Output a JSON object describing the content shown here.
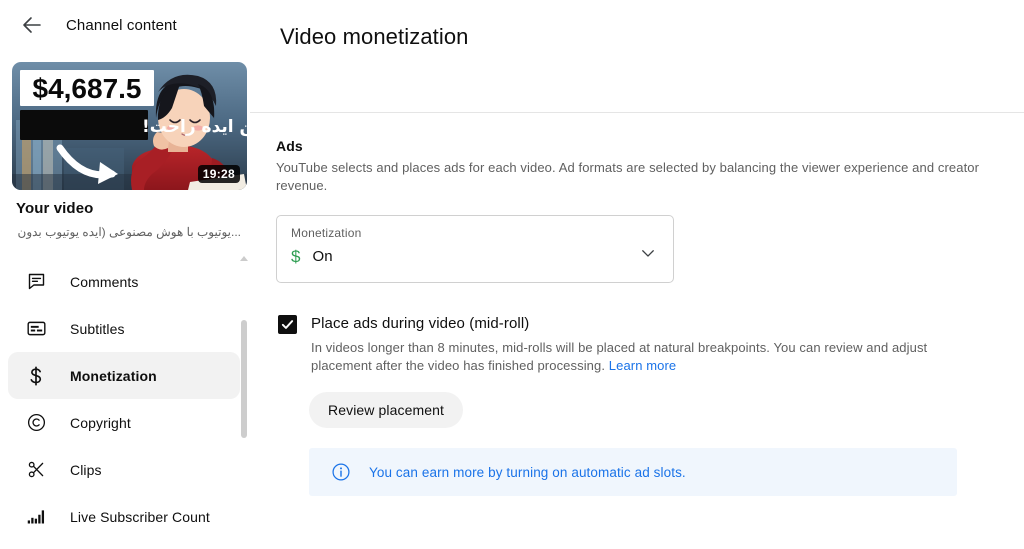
{
  "sidebar": {
    "back_icon": "back-arrow-icon",
    "header_title": "Channel content",
    "video": {
      "thumbnail": {
        "price_text": "$4,687.5",
        "headline_text": "با این ایده راحت!",
        "duration": "19:28",
        "arrow_icon": "curved-arrow-icon"
      },
      "title": "Your video",
      "subtitle": "...یوتیوب با هوش مصنوعی (ایده یوتیوب بدون چهره)"
    },
    "items": [
      {
        "label": "Comments",
        "icon": "comment-icon",
        "active": false
      },
      {
        "label": "Subtitles",
        "icon": "subtitles-icon",
        "active": false
      },
      {
        "label": "Monetization",
        "icon": "dollar-icon",
        "active": true
      },
      {
        "label": "Copyright",
        "icon": "copyright-icon",
        "active": false
      },
      {
        "label": "Clips",
        "icon": "scissors-icon",
        "active": false
      },
      {
        "label": "Live Subscriber Count",
        "icon": "bar-chart-icon",
        "active": false
      }
    ],
    "scrollbar": "vertical-scrollbar"
  },
  "main": {
    "page_title": "Video monetization",
    "ads": {
      "section_title": "Ads",
      "section_desc": "YouTube selects and places ads for each video. Ad formats are selected by balancing the viewer experience and creator revenue.",
      "monetization_select": {
        "label": "Monetization",
        "value": "On",
        "value_icon": "dollar-icon",
        "chevron_icon": "chevron-down-icon"
      },
      "midroll": {
        "checked": true,
        "label": "Place ads during video (mid-roll)",
        "description": "In videos longer than 8 minutes, mid-rolls will be placed at natural breakpoints. You can review and adjust placement after the video has finished processing.",
        "learn_more": "Learn more",
        "review_button": "Review placement"
      },
      "info_banner": {
        "icon": "info-circle-icon",
        "text": "You can earn more by turning on automatic ad slots."
      }
    }
  },
  "colors": {
    "accent_blue": "#1a73e8",
    "money_green": "#2e9e52",
    "banner_bg": "#f0f6fd",
    "active_bg": "#f2f2f2"
  }
}
